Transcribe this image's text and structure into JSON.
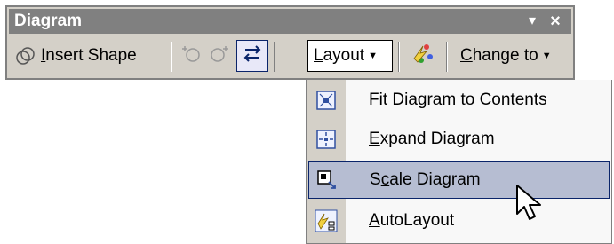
{
  "toolbar": {
    "title": "Diagram",
    "insert_shape": {
      "underlined": "I",
      "rest": "nsert Shape"
    },
    "layout": {
      "underlined": "L",
      "rest": "ayout"
    },
    "change_to": {
      "underlined": "C",
      "rest": "hange to"
    }
  },
  "menu": {
    "items": [
      {
        "underlined": "F",
        "rest": "it Diagram to Contents",
        "icon": "fit-diagram-icon",
        "highlighted": false
      },
      {
        "underlined": "E",
        "rest": "xpand Diagram",
        "icon": "expand-diagram-icon",
        "highlighted": false
      },
      {
        "prefix": "S",
        "underlined": "c",
        "rest": "ale Diagram",
        "icon": "scale-diagram-icon",
        "highlighted": true
      },
      {
        "underlined": "A",
        "rest": "utoLayout",
        "icon": "autolayout-icon",
        "highlighted": false
      }
    ]
  },
  "colors": {
    "toolbar_bg": "#d4d0c8",
    "title_bg": "#808080",
    "highlight_bg": "#b6bdd2",
    "highlight_border": "#0a246a"
  }
}
